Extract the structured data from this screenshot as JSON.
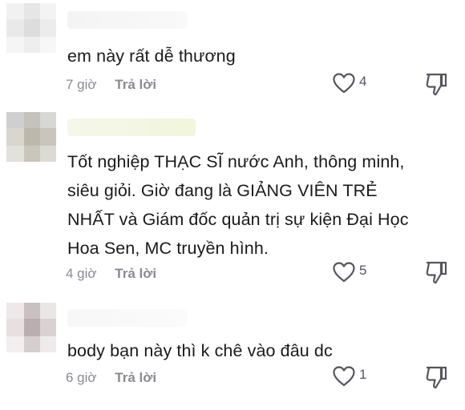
{
  "comments": [
    {
      "text": "em này rất dễ thương",
      "time": "7 giờ",
      "reply": "Trả lời",
      "likes": "4",
      "icons": {
        "like": "heart-outline-icon",
        "dislike": "thumbs-down-icon"
      }
    },
    {
      "text": "Tốt nghiệp THẠC SĨ nước Anh, thông minh,\nsiêu giỏi. Giờ đang là GIẢNG VIÊN TRẺ\nNHẤT và Giám đốc quản trị sự kiện Đại Học\nHoa Sen, MC truyền hình.",
      "time": "4 giờ",
      "reply": "Trả lời",
      "likes": "5",
      "icons": {
        "like": "heart-outline-icon",
        "dislike": "thumbs-down-icon"
      }
    },
    {
      "text": "body bạn này thì k chê vào đâu dc",
      "time": "6 giờ",
      "reply": "Trả lời",
      "likes": "1",
      "icons": {
        "like": "heart-outline-icon",
        "dislike": "thumbs-down-icon"
      }
    }
  ],
  "colors": {
    "text": "#1a1a1a",
    "meta": "#8a8b91",
    "icon": "#55565c"
  }
}
